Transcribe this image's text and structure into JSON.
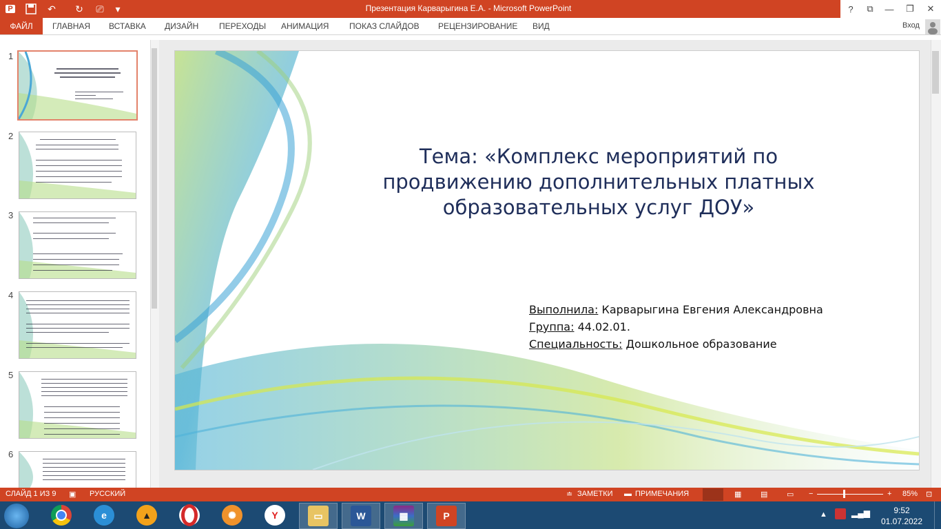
{
  "titlebar": {
    "title": "Презентация Карварыгина Е.А. -  Microsoft PowerPoint",
    "help": "?",
    "qa_icons": [
      "powerpoint-app-icon",
      "save-icon",
      "undo-icon",
      "redo-icon",
      "start-from-beginning-icon",
      "customize-qa-icon"
    ]
  },
  "ribbon": {
    "file": "ФАЙЛ",
    "tabs": [
      "ГЛАВНАЯ",
      "ВСТАВКА",
      "ДИЗАЙН",
      "ПЕРЕХОДЫ",
      "АНИМАЦИЯ",
      "ПОКАЗ СЛАЙДОВ",
      "РЕЦЕНЗИРОВАНИЕ",
      "ВИД"
    ],
    "login": "Вход"
  },
  "thumbnails": [
    {
      "num": "1"
    },
    {
      "num": "2"
    },
    {
      "num": "3"
    },
    {
      "num": "4"
    },
    {
      "num": "5"
    },
    {
      "num": "6"
    }
  ],
  "slide": {
    "title": "Тема: «Комплекс мероприятий по продвижению дополнительных платных образовательных услуг ДОУ»",
    "author_label": "Выполнила:",
    "author_value": " Карварыгина Евгения Александровна",
    "group_label": "Группа:",
    "group_value": " 44.02.01.",
    "spec_label": "Специальность:",
    "spec_value": " Дошкольное образование"
  },
  "status": {
    "slide": "СЛАЙД 1 ИЗ 9",
    "lang": "РУССКИЙ",
    "notes": "ЗАМЕТКИ",
    "comments": "ПРИМЕЧАНИЯ",
    "zoom": "85%"
  },
  "taskbar": {
    "apps": [
      "chrome",
      "internet-explorer",
      "aimp",
      "opera",
      "settings-app",
      "yandex",
      "file-explorer",
      "word",
      "winrar",
      "powerpoint"
    ],
    "time": "9:52",
    "date": "01.07.2022"
  },
  "colors": {
    "accent": "#d04423",
    "title_text": "#1f2e5a",
    "taskbar": "#1c4a73"
  }
}
